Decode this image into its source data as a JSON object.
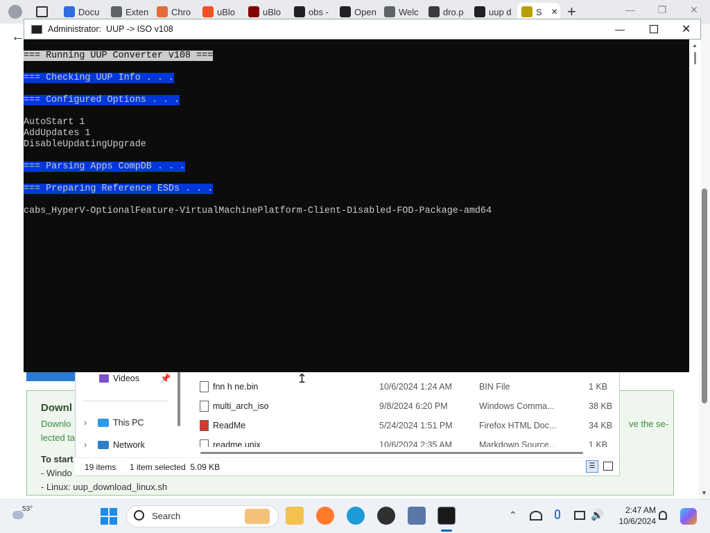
{
  "browser": {
    "tabs": [
      {
        "label": "Docu",
        "icon": "dropbox-icon",
        "color": "#2f6de1"
      },
      {
        "label": "Exten",
        "icon": "puzzle-icon",
        "color": "#5f6368"
      },
      {
        "label": "Chro",
        "icon": "rainbow-icon",
        "color": "#e46c3a"
      },
      {
        "label": "uBlo",
        "icon": "windows-logo-icon",
        "color": "#f25022"
      },
      {
        "label": "uBlo",
        "icon": "ublock-icon",
        "color": "#800000"
      },
      {
        "label": "obs -",
        "icon": "search-icon",
        "color": "#202124"
      },
      {
        "label": "Open",
        "icon": "github-icon",
        "color": "#202124"
      },
      {
        "label": "Welc",
        "icon": "page-icon",
        "color": "#5f6368"
      },
      {
        "label": "dro.p",
        "icon": "thumbnail-icon",
        "color": "#3b3b3b"
      },
      {
        "label": "uup d",
        "icon": "search-icon",
        "color": "#202124"
      },
      {
        "label": "S",
        "icon": "uup-icon",
        "color": "#b7a000"
      }
    ],
    "page_text": {
      "download_heading": "Downl",
      "download_text_1": "Downlo",
      "download_text_2": "lected ta",
      "download_right_text": "ve the se-",
      "to_start": "To start",
      "windows_line": "- Windo",
      "linux_line": "- Linux: uup_download_linux.sh"
    }
  },
  "console": {
    "title": "Administrator:  UUP -> ISO v108",
    "lines": [
      {
        "text": "=== Running UUP Converter v108 ===",
        "style": "hl-first"
      },
      {
        "text": "",
        "style": ""
      },
      {
        "text": "=== Checking UUP Info . . .",
        "style": "hl"
      },
      {
        "text": "",
        "style": ""
      },
      {
        "text": "=== Configured Options . . .",
        "style": "hl"
      },
      {
        "text": "",
        "style": ""
      },
      {
        "text": "AutoStart 1",
        "style": ""
      },
      {
        "text": "AddUpdates 1",
        "style": ""
      },
      {
        "text": "DisableUpdatingUpgrade",
        "style": ""
      },
      {
        "text": "",
        "style": ""
      },
      {
        "text": "=== Parsing Apps CompDB . . .",
        "style": "hl"
      },
      {
        "text": "",
        "style": ""
      },
      {
        "text": "=== Preparing Reference ESDs . . .",
        "style": "hl"
      },
      {
        "text": "",
        "style": ""
      },
      {
        "text": "cabs_HyperV-OptionalFeature-VirtualMachinePlatform-Client-Disabled-FOD-Package-amd64",
        "style": ""
      }
    ]
  },
  "explorer": {
    "nav": {
      "videos": "Videos",
      "this_pc": "This PC",
      "network": "Network"
    },
    "files": [
      {
        "name": "fnn h ne.bin",
        "date": "10/6/2024 1:24 AM",
        "type": "BIN File",
        "size": "1 KB"
      },
      {
        "name": "multi_arch_iso",
        "date": "9/8/2024 6:20 PM",
        "type": "Windows Comma...",
        "size": "38 KB"
      },
      {
        "name": "ReadMe",
        "date": "5/24/2024 1:51 PM",
        "type": "Firefox HTML Doc...",
        "size": "34 KB"
      },
      {
        "name": "readme.unix",
        "date": "10/6/2024 2:35 AM",
        "type": "Markdown Source...",
        "size": "1 KB"
      }
    ],
    "status": {
      "items": "19 items",
      "selected": "1 item selected  5.09 KB"
    }
  },
  "taskbar": {
    "weather": "53°",
    "search_placeholder": "Search",
    "time": "2:47 AM",
    "date": "10/6/2024"
  }
}
